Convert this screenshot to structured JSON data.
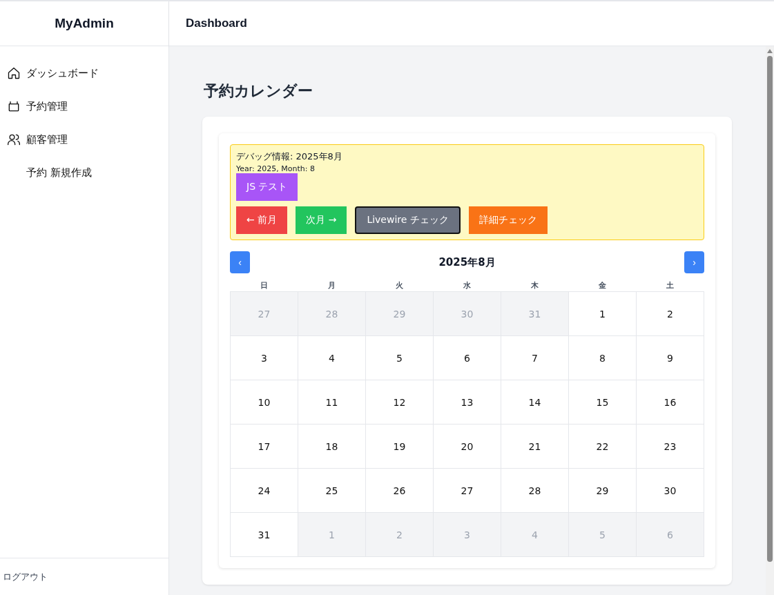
{
  "sidebar": {
    "brand": "MyAdmin",
    "items": [
      {
        "label": "ダッシュボード"
      },
      {
        "label": "予約管理"
      },
      {
        "label": "顧客管理"
      },
      {
        "label": "予約 新規作成"
      }
    ],
    "logout": "ログアウト"
  },
  "header": {
    "title": "Dashboard"
  },
  "page_title": "予約カレンダー",
  "debug": {
    "heading": "デバッグ情報: 2025年8月",
    "detail": "Year: 2025, Month: 8",
    "buttons": [
      {
        "label": "JS テスト",
        "color": "#a855f7",
        "outlined": false
      },
      {
        "label": "← 前月",
        "color": "#ef4444",
        "outlined": false
      },
      {
        "label": "次月 →",
        "color": "#22c55e",
        "outlined": false
      },
      {
        "label": "Livewire チェック",
        "color": "#6b7280",
        "outlined": true
      },
      {
        "label": "詳細チェック",
        "color": "#f97316",
        "outlined": false
      }
    ]
  },
  "calendar": {
    "prev": "‹",
    "next": "›",
    "month": "2025年8月",
    "weekdays": [
      "日",
      "月",
      "火",
      "水",
      "木",
      "金",
      "土"
    ],
    "days": [
      {
        "label": "27",
        "in_month": false
      },
      {
        "label": "28",
        "in_month": false
      },
      {
        "label": "29",
        "in_month": false
      },
      {
        "label": "30",
        "in_month": false
      },
      {
        "label": "31",
        "in_month": false
      },
      {
        "label": "1",
        "in_month": true
      },
      {
        "label": "2",
        "in_month": true
      },
      {
        "label": "3",
        "in_month": true
      },
      {
        "label": "4",
        "in_month": true
      },
      {
        "label": "5",
        "in_month": true
      },
      {
        "label": "6",
        "in_month": true
      },
      {
        "label": "7",
        "in_month": true
      },
      {
        "label": "8",
        "in_month": true
      },
      {
        "label": "9",
        "in_month": true
      },
      {
        "label": "10",
        "in_month": true
      },
      {
        "label": "11",
        "in_month": true
      },
      {
        "label": "12",
        "in_month": true
      },
      {
        "label": "13",
        "in_month": true
      },
      {
        "label": "14",
        "in_month": true
      },
      {
        "label": "15",
        "in_month": true
      },
      {
        "label": "16",
        "in_month": true
      },
      {
        "label": "17",
        "in_month": true
      },
      {
        "label": "18",
        "in_month": true
      },
      {
        "label": "19",
        "in_month": true
      },
      {
        "label": "20",
        "in_month": true
      },
      {
        "label": "21",
        "in_month": true
      },
      {
        "label": "22",
        "in_month": true
      },
      {
        "label": "23",
        "in_month": true
      },
      {
        "label": "24",
        "in_month": true
      },
      {
        "label": "25",
        "in_month": true
      },
      {
        "label": "26",
        "in_month": true
      },
      {
        "label": "27",
        "in_month": true
      },
      {
        "label": "28",
        "in_month": true
      },
      {
        "label": "29",
        "in_month": true
      },
      {
        "label": "30",
        "in_month": true
      },
      {
        "label": "31",
        "in_month": true
      },
      {
        "label": "1",
        "in_month": false
      },
      {
        "label": "2",
        "in_month": false
      },
      {
        "label": "3",
        "in_month": false
      },
      {
        "label": "4",
        "in_month": false
      },
      {
        "label": "5",
        "in_month": false
      },
      {
        "label": "6",
        "in_month": false
      }
    ]
  }
}
